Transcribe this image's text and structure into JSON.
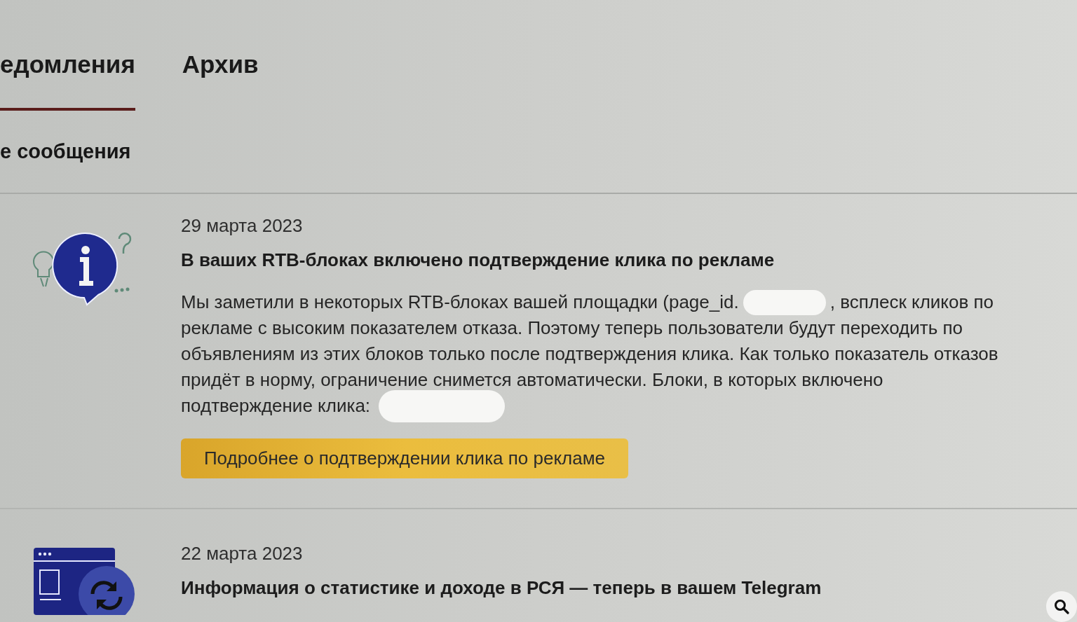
{
  "tabs": [
    {
      "label": "едомления",
      "selected": true
    },
    {
      "label": "Архив",
      "selected": false
    }
  ],
  "section_heading": "е сообщения",
  "notifications": [
    {
      "kind": "info",
      "date": "29 марта 2023",
      "title": "В ваших RTB-блоках включено подтверждение клика по рекламе",
      "body_lines": [
        [
          {
            "kind": "text",
            "text": "Мы заметили в некоторых RTB-блоках вашей площадки (page_id."
          },
          {
            "kind": "redacted"
          },
          {
            "kind": "text",
            "text": ", всплеск кликов по"
          }
        ],
        [
          {
            "kind": "text",
            "text": "рекламе с высоким показателем отказа. Поэтому теперь пользователи будут переходить по"
          }
        ],
        [
          {
            "kind": "text",
            "text": "объявлениям из этих блоков только после подтверждения клика. Как только показатель отказов"
          }
        ],
        [
          {
            "kind": "text",
            "text": "придёт в норму, ограничение снимется автоматически. Блоки, в которых включено"
          }
        ],
        [
          {
            "kind": "text",
            "text": "подтверждение клика:"
          },
          {
            "kind": "redacted"
          }
        ]
      ],
      "button": "Подробнее о подтверждении клика по рекламе"
    },
    {
      "kind": "update",
      "date": "22 марта 2023",
      "title": "Информация о статистике и доходе в РСЯ — теперь в вашем Telegram"
    }
  ]
}
